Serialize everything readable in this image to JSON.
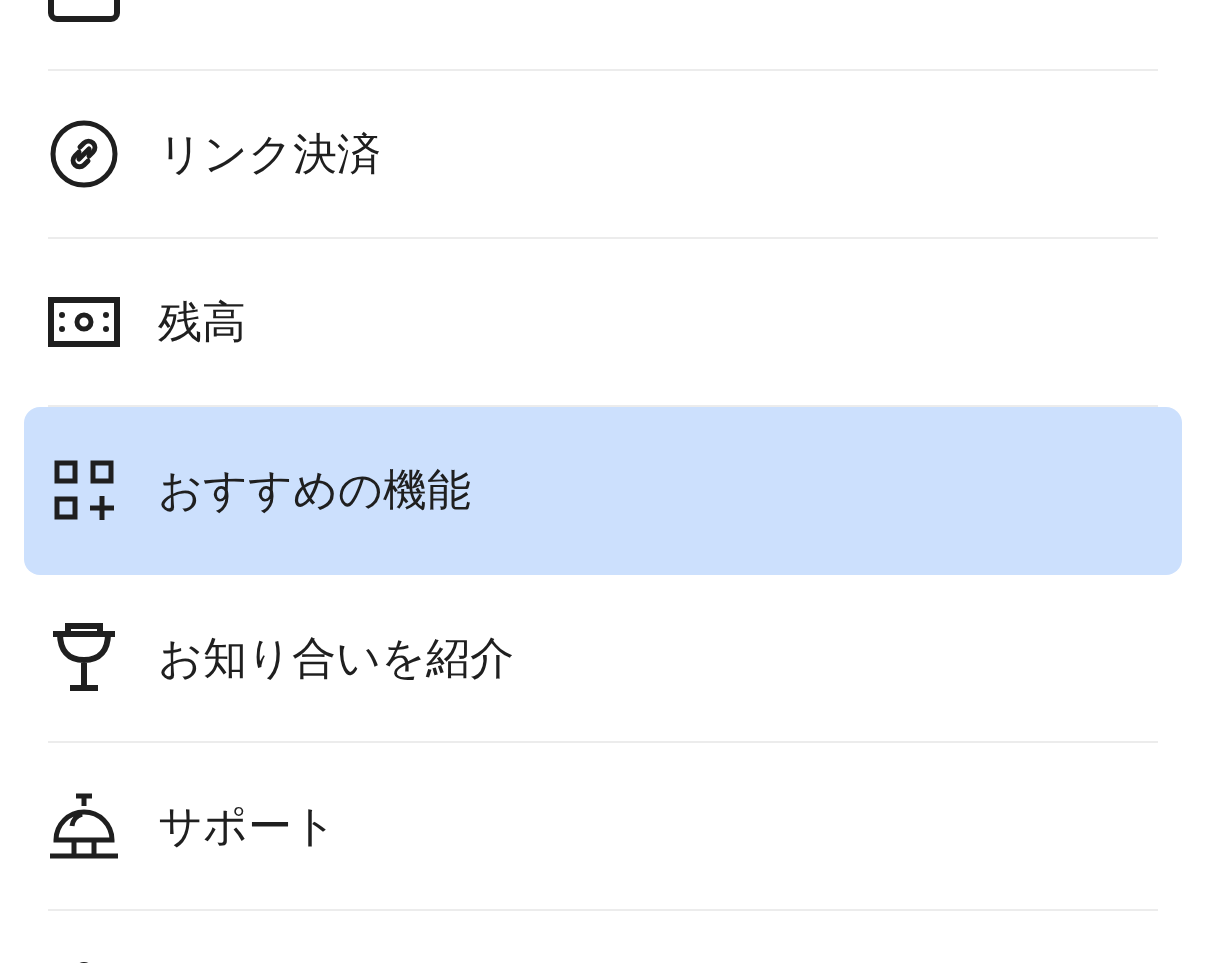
{
  "menu_items": [
    {
      "selected": false
    },
    {
      "label": "リンク決済",
      "selected": false
    },
    {
      "label": "残高",
      "selected": false
    },
    {
      "label": "おすすめの機能",
      "selected": true
    },
    {
      "label": "お知り合いを紹介",
      "selected": false
    },
    {
      "label": "サポート",
      "selected": false
    },
    {
      "selected": false
    }
  ]
}
